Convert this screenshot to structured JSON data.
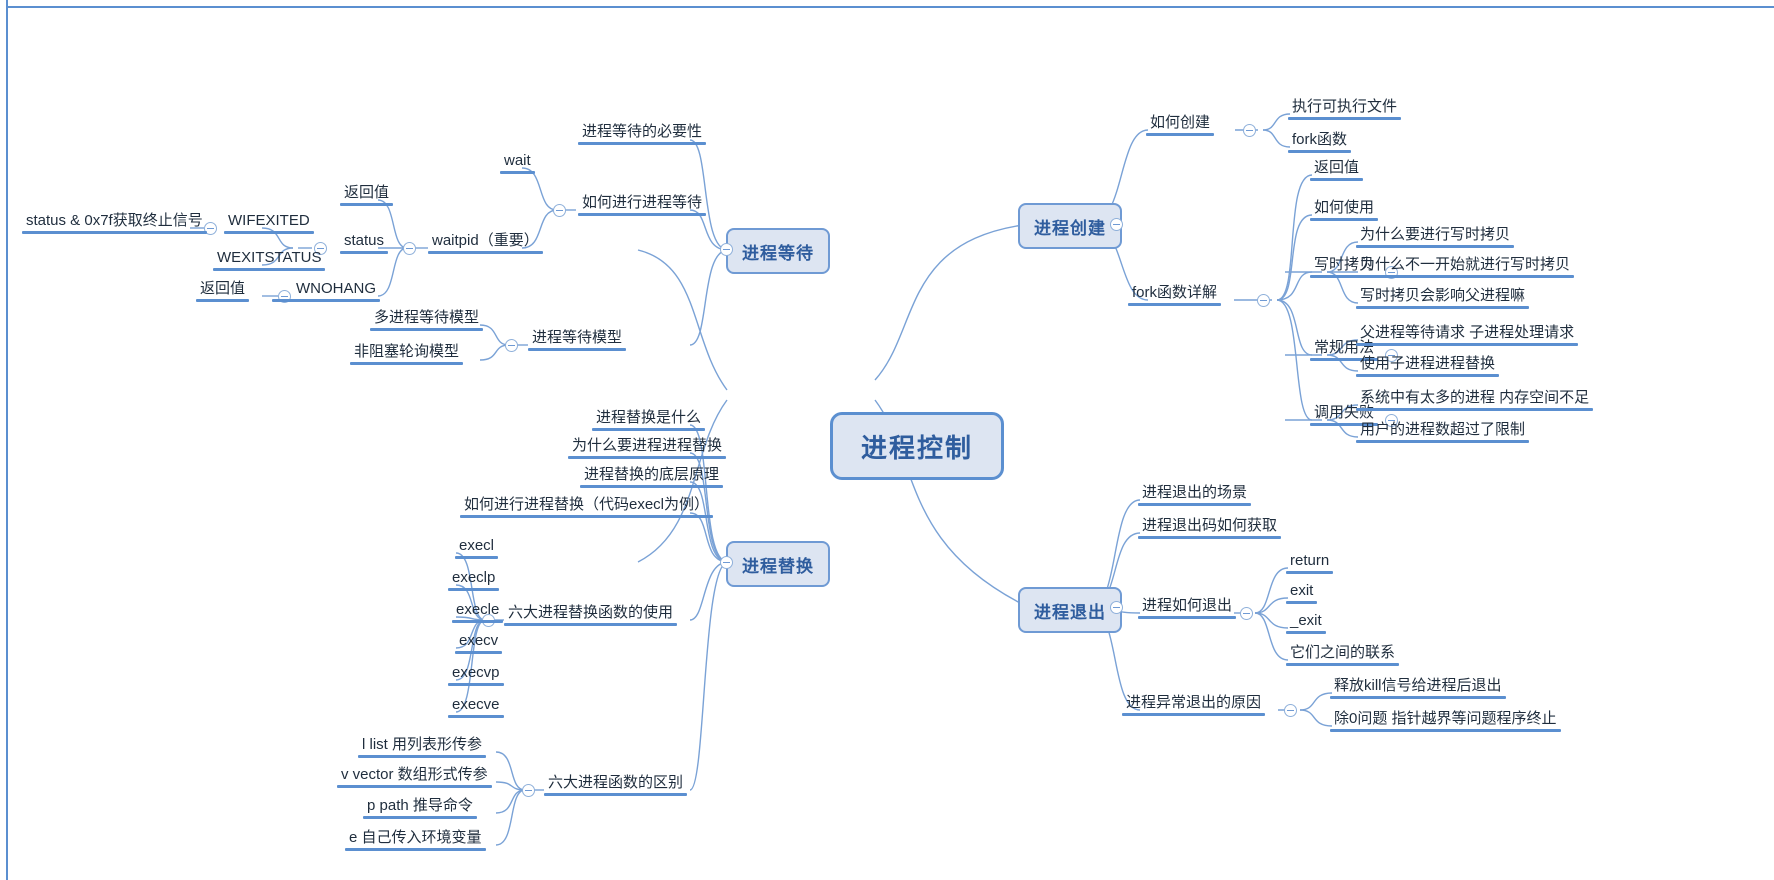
{
  "document": {
    "type": "mind-map",
    "root": "进程控制",
    "accent": "#5b8fd0",
    "node_fill": "#dde5f2",
    "text_color": "#1f2d3d",
    "title_color": "#2f5d9e"
  },
  "branches": {
    "process_wait": {
      "label": "进程等待",
      "children": {
        "necessity": "进程等待的必要性",
        "how_to_wait": "如何进行进程等待",
        "wait": "wait",
        "waitpid": "waitpid（重要）",
        "return_value_1": "返回值",
        "status": "status",
        "wifexited": "WIFEXITED",
        "wexitstatus": "WEXITSTATUS",
        "status_mask": "status & 0x7f获取终止信号",
        "return_value_2": "返回值",
        "wnohang": "WNOHANG",
        "wait_model": "进程等待模型",
        "multi_process_model": "多进程等待模型",
        "nonblocking_poll_model": "非阻塞轮询模型"
      }
    },
    "process_replace": {
      "label": "进程替换",
      "children": {
        "what_is": "进程替换是什么",
        "why": "为什么要进程进程替换",
        "principle": "进程替换的底层原理",
        "how_to": "如何进行进程替换（代码execl为例）",
        "six_usage": "六大进程替换函数的使用",
        "exec_list": [
          "execl",
          "execlp",
          "execle",
          "execv",
          "execvp",
          "execve"
        ],
        "six_diff": "六大进程函数的区别",
        "diff_list": [
          "l list 用列表形传参",
          "v vector 数组形式传参",
          "p path 推导命令",
          "e 自己传入环境变量"
        ]
      }
    },
    "process_create": {
      "label": "进程创建",
      "children": {
        "how_to_create": "如何创建",
        "how_to_create_items": [
          "执行可执行文件",
          "fork函数"
        ],
        "fork_detail": "fork函数详解",
        "return_value": "返回值",
        "how_to_use": "如何使用",
        "cow": "写时拷贝",
        "cow_items": [
          "为什么要进行写时拷贝",
          "为什么不一开始就进行写时拷贝",
          "写时拷贝会影响父进程嘛"
        ],
        "common_usage": "常规用法",
        "common_usage_items": [
          "父进程等待请求 子进程处理请求",
          "使用子进程进程替换"
        ],
        "call_fail": "调用失败",
        "call_fail_items": [
          "系统中有太多的进程 内存空间不足",
          "用户的进程数超过了限制"
        ]
      }
    },
    "process_exit": {
      "label": "进程退出",
      "children": {
        "scenes": "进程退出的场景",
        "get_exit_code": "进程退出码如何获取",
        "how_to_exit": "进程如何退出",
        "how_to_exit_items": [
          "return",
          "exit",
          "_exit",
          "它们之间的联系"
        ],
        "abnormal_reason": "进程异常退出的原因",
        "abnormal_items": [
          "释放kill信号给进程后退出",
          "除0问题 指针越界等问题程序终止"
        ]
      }
    }
  }
}
